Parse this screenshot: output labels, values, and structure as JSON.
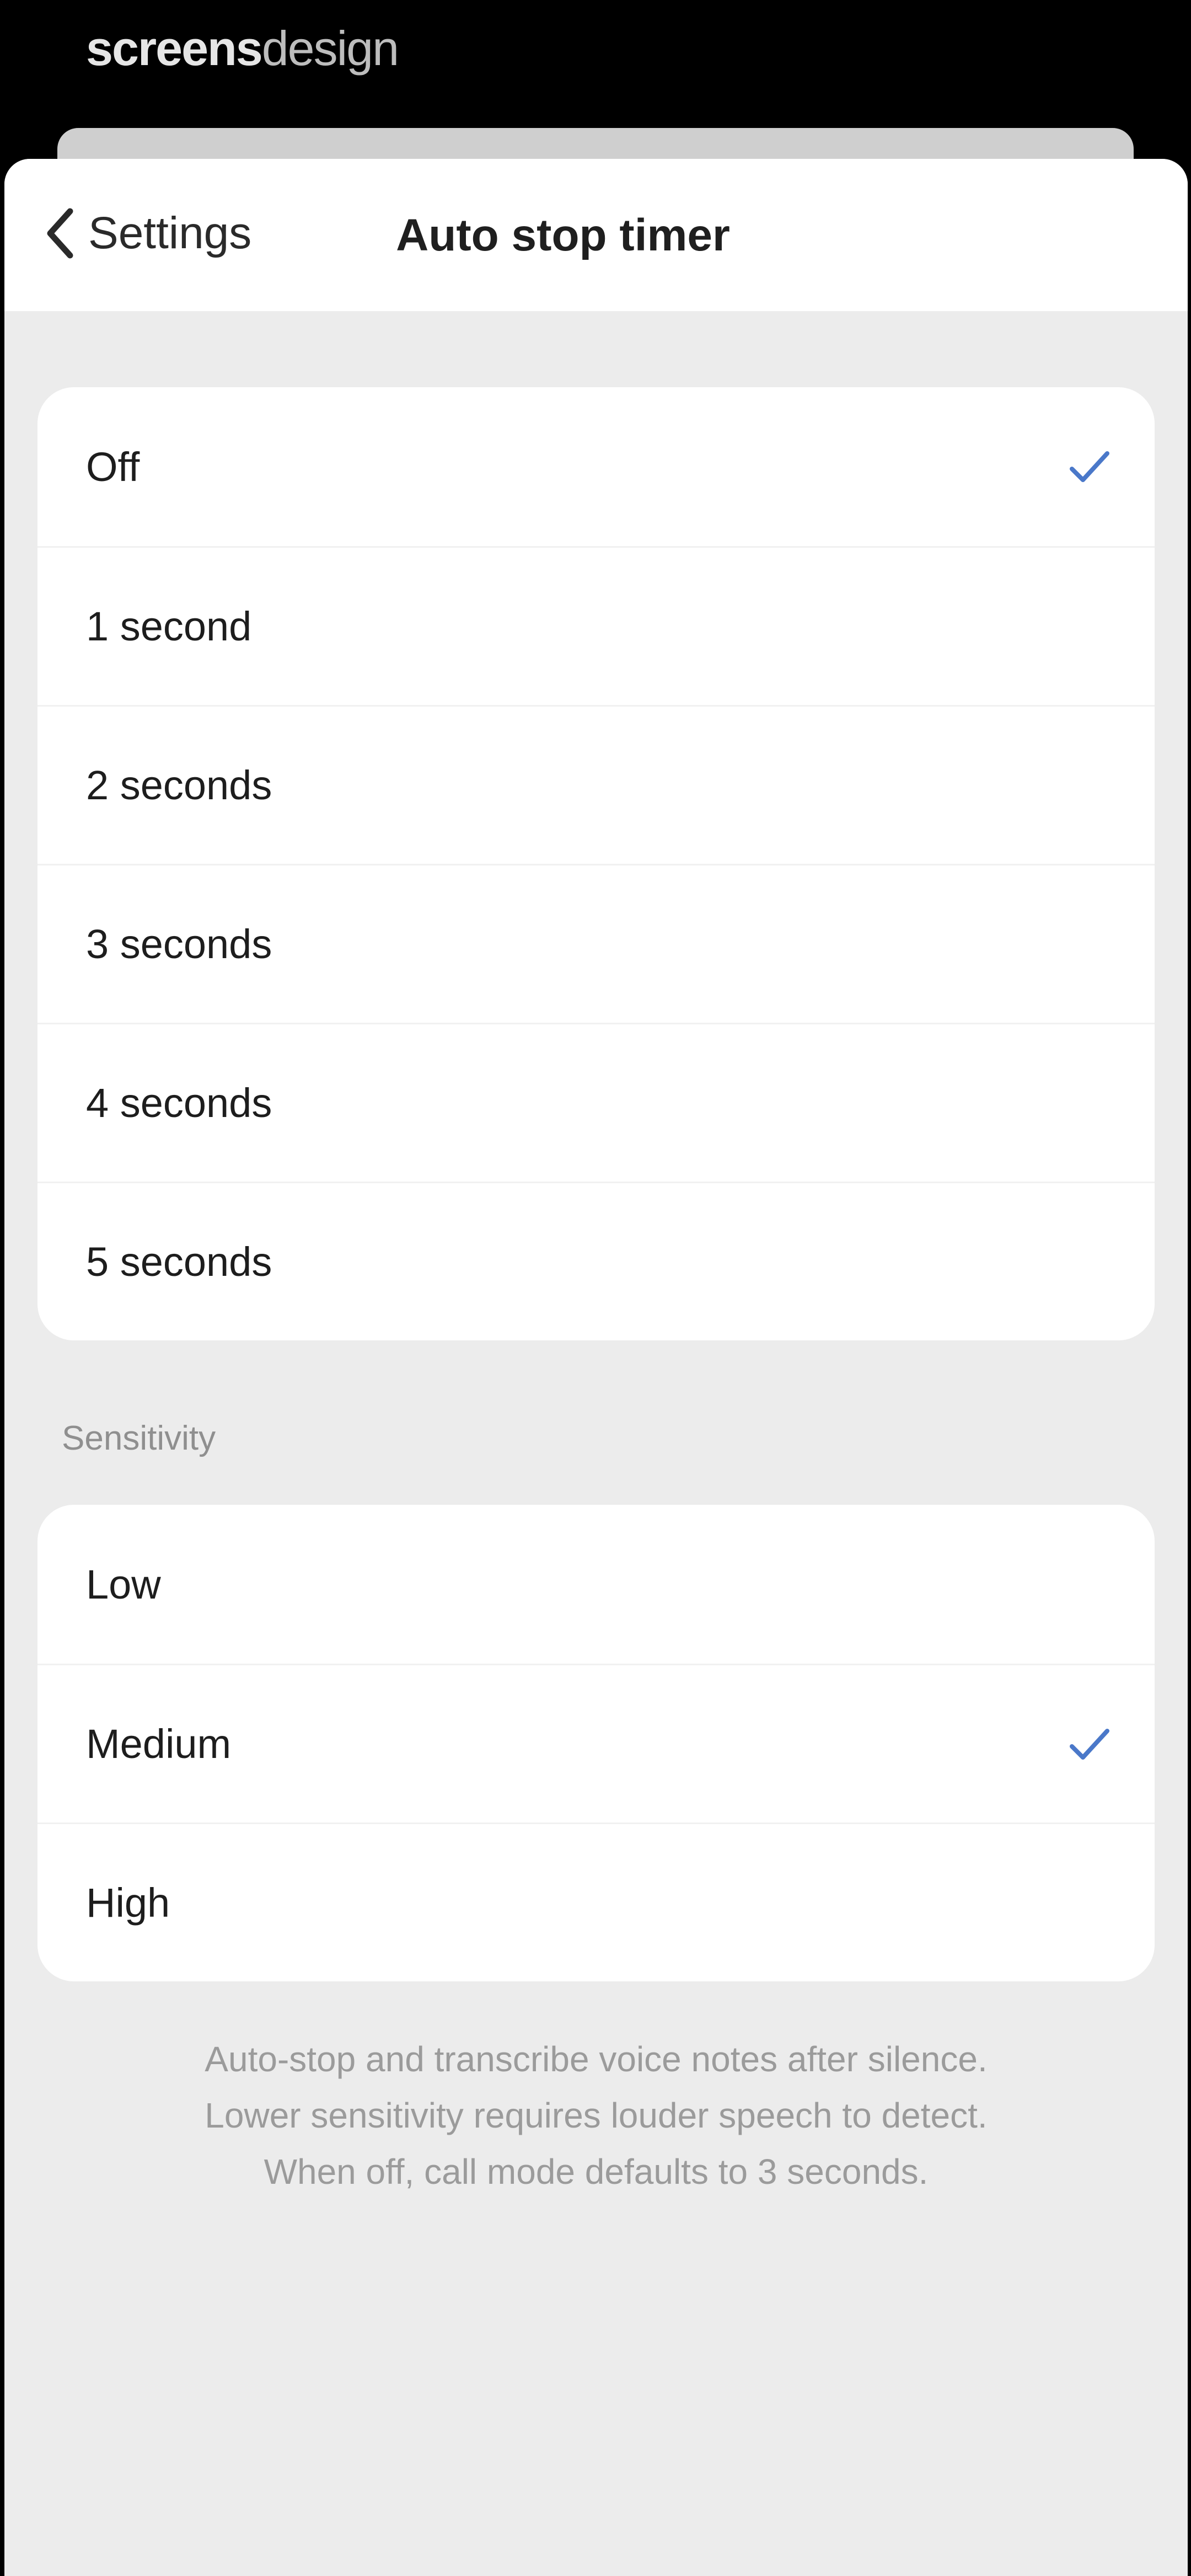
{
  "watermark": {
    "part1": "screens",
    "part2": "design"
  },
  "nav": {
    "back_label": "Settings",
    "title": "Auto stop timer"
  },
  "timer_options": [
    {
      "label": "Off",
      "selected": true
    },
    {
      "label": "1 second",
      "selected": false
    },
    {
      "label": "2 seconds",
      "selected": false
    },
    {
      "label": "3 seconds",
      "selected": false
    },
    {
      "label": "4 seconds",
      "selected": false
    },
    {
      "label": "5 seconds",
      "selected": false
    }
  ],
  "sensitivity": {
    "header": "Sensitivity",
    "options": [
      {
        "label": "Low",
        "selected": false
      },
      {
        "label": "Medium",
        "selected": true
      },
      {
        "label": "High",
        "selected": false
      }
    ]
  },
  "footer": {
    "line1": "Auto-stop and transcribe voice notes after silence.",
    "line2": "Lower sensitivity requires louder speech to detect.",
    "line3": "When off, call mode defaults to 3 seconds."
  },
  "colors": {
    "accent": "#4a78c9",
    "background": "#ececec",
    "card": "#ffffff"
  },
  "icons": {
    "back": "chevron-left-icon",
    "selected": "checkmark-icon"
  }
}
